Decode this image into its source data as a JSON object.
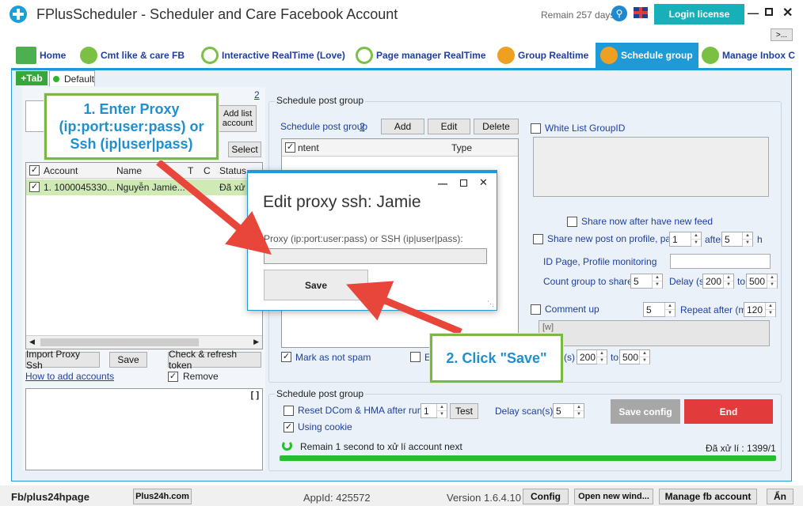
{
  "titlebar": {
    "title": "FPlusScheduler - Scheduler and Care Facebook Account",
    "remain": "Remain 257 days",
    "login_license": "Login license",
    "more": ">..."
  },
  "tabs": [
    {
      "label": "Home"
    },
    {
      "label": "Cmt like & care FB"
    },
    {
      "label": "Interactive RealTime (Love)"
    },
    {
      "label": "Page manager RealTime"
    },
    {
      "label": "Group Realtime"
    },
    {
      "label": "Schedule group"
    },
    {
      "label": "Manage Inbox C"
    }
  ],
  "subtabs": {
    "add": "+Tab",
    "default": "Default"
  },
  "left": {
    "link_number": "2",
    "add_list_account": "Add list account",
    "select": "Select",
    "columns": [
      "Account",
      "Name",
      "T",
      "C",
      "Status"
    ],
    "row": {
      "account": "1. 1000045330...",
      "name": "Nguyễn Jamie...",
      "status": "Đã xử"
    },
    "import_proxy": "Import Proxy Ssh",
    "save": "Save",
    "check_refresh": "Check & refresh token",
    "how_to_add": "How to add accounts",
    "remove": "Remove",
    "log_tag": "[ ]"
  },
  "schedule": {
    "group_title": "Schedule post group",
    "list_label": "Schedule post group",
    "list_help": "?",
    "add": "Add",
    "edit": "Edit",
    "delete": "Delete",
    "col_content": "ntent",
    "col_type": "Type",
    "white_list": "White List GroupID",
    "share_now": "Share now after have new feed",
    "share_profile": "Share new post on profile, page",
    "share_profile_val": "1",
    "after": "after",
    "after_val": "5",
    "h": "h",
    "id_page": "ID Page, Profile monitoring",
    "count_group": "Count group to share",
    "count_group_val": "5",
    "delay": "Delay (s)",
    "delay_from": "200",
    "to": "to",
    "delay_to": "500",
    "comment_up": "Comment up",
    "comment_val": "5",
    "repeat_after": "Repeat after (m)",
    "repeat_val": "120",
    "comment_text": "[w]",
    "mark_spam": "Mark as not spam",
    "e_label": "E",
    "s_label": "(s)",
    "delay2_from": "200",
    "to2": "to",
    "delay2_to": "500"
  },
  "bottom_group": {
    "title": "Schedule post group",
    "reset_dcom": "Reset DCom & HMA after runned",
    "reset_val": "1",
    "test": "Test",
    "delay_scan": "Delay scan(s)",
    "delay_scan_val": "5",
    "using_cookie": "Using cookie",
    "save_config": "Save config",
    "end": "End",
    "remain_msg": "Remain 1 second to xử lí account next",
    "processed": "Đã xử lí : 1399/1"
  },
  "statusbar": {
    "fb": "Fb/plus24hpage",
    "site": "Plus24h.com",
    "appid": "AppId: 425572",
    "version": "Version 1.6.4.10",
    "config": "Config",
    "open_new": "Open new wind...",
    "manage_fb": "Manage fb account",
    "an": "Ẩn"
  },
  "dialog": {
    "title": "Edit proxy ssh: Jamie",
    "field_label": "Proxy (ip:port:user:pass) or SSH (ip|user|pass):",
    "field_value": "",
    "save": "Save"
  },
  "callouts": {
    "one": "1. Enter Proxy (ip:port:user:pass) or Ssh (ip|user|pass)",
    "two": "2. Click \"Save\""
  },
  "colors": {
    "accent": "#00a2e8",
    "end_red": "#e23b3b",
    "callout_border": "#7bb843",
    "callout_text": "#1f8fcf",
    "arrow": "#e8463a",
    "progress": "#22c02b"
  }
}
